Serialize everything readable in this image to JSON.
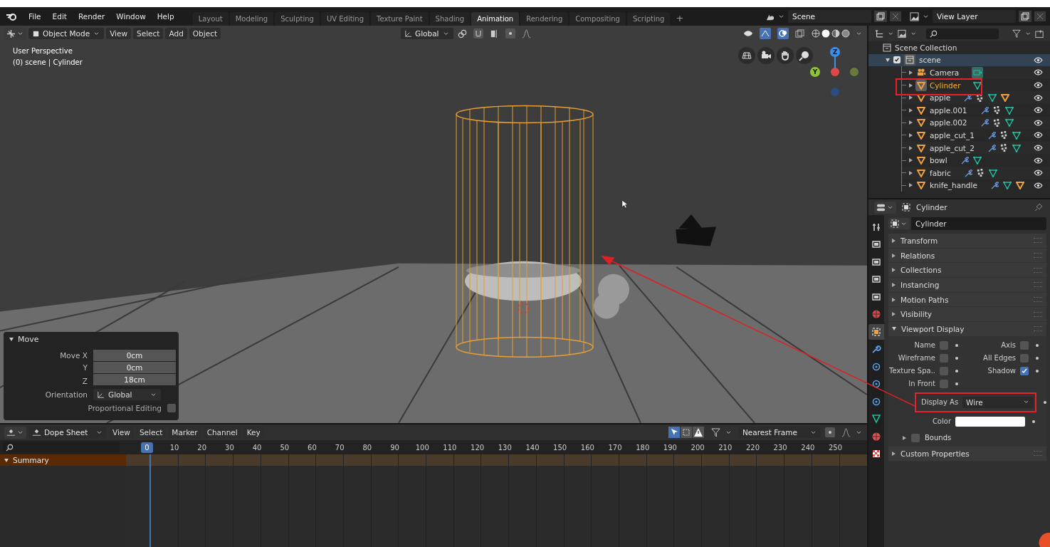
{
  "menu": [
    "File",
    "Edit",
    "Render",
    "Window",
    "Help"
  ],
  "workspaces": [
    {
      "label": "Layout",
      "selected": false
    },
    {
      "label": "Modeling",
      "selected": false
    },
    {
      "label": "Sculpting",
      "selected": false
    },
    {
      "label": "UV Editing",
      "selected": false
    },
    {
      "label": "Texture Paint",
      "selected": false
    },
    {
      "label": "Shading",
      "selected": false
    },
    {
      "label": "Animation",
      "selected": true
    },
    {
      "label": "Rendering",
      "selected": false
    },
    {
      "label": "Compositing",
      "selected": false
    },
    {
      "label": "Scripting",
      "selected": false
    }
  ],
  "add_workspace": "+",
  "scene": "Scene",
  "view_layer": "View Layer",
  "viewport": {
    "mode": "Object Mode",
    "menus": [
      "View",
      "Select",
      "Add",
      "Object"
    ],
    "orientation": "Global",
    "info": [
      "User Perspective",
      "(0) scene | Cylinder"
    ],
    "axes": [
      "Z",
      "Y"
    ]
  },
  "move_panel": {
    "title": "Move",
    "expanded": true,
    "fields": [
      {
        "label": "Move X",
        "value": "0cm"
      },
      {
        "label": "Y",
        "value": "0cm"
      },
      {
        "label": "Z",
        "value": "18cm"
      }
    ],
    "orientation_label": "Orientation",
    "orientation": "Global",
    "proportional_label": "Proportional Editing",
    "proportional": false
  },
  "dope_sheet": {
    "mode": "Dope Sheet",
    "menus": [
      "View",
      "Select",
      "Marker",
      "Channel",
      "Key"
    ],
    "snap": "Nearest Frame",
    "current_frame": "0",
    "frames": [
      "10",
      "20",
      "30",
      "40",
      "50",
      "60",
      "70",
      "80",
      "90",
      "100",
      "110",
      "120",
      "130",
      "140",
      "150",
      "160",
      "170",
      "180",
      "190",
      "200",
      "210",
      "220",
      "230",
      "240",
      "250"
    ],
    "summary": {
      "label": "Summary",
      "expanded": true
    }
  },
  "outliner": {
    "root": "Scene Collection",
    "collection": {
      "name": "scene",
      "checked": true,
      "expanded": true
    },
    "items": [
      {
        "name": "Camera",
        "kind": "camera",
        "selected": false,
        "icons": [
          {
            "kind": "camera_data"
          }
        ]
      },
      {
        "name": "Cylinder",
        "kind": "mesh",
        "selected": true,
        "icons": [
          {
            "kind": "mesh_data"
          }
        ]
      },
      {
        "name": "apple",
        "kind": "mesh",
        "selected": false,
        "icons": [
          {
            "kind": "modifier"
          },
          {
            "kind": "particles"
          },
          {
            "kind": "mesh_data"
          },
          {
            "kind": "object"
          }
        ]
      },
      {
        "name": "apple.001",
        "kind": "mesh",
        "selected": false,
        "icons": [
          {
            "kind": "modifier"
          },
          {
            "kind": "particles"
          },
          {
            "kind": "mesh_data"
          }
        ]
      },
      {
        "name": "apple.002",
        "kind": "mesh",
        "selected": false,
        "icons": [
          {
            "kind": "modifier"
          },
          {
            "kind": "particles"
          },
          {
            "kind": "mesh_data"
          }
        ]
      },
      {
        "name": "apple_cut_1",
        "kind": "mesh",
        "selected": false,
        "icons": [
          {
            "kind": "modifier"
          },
          {
            "kind": "particles"
          },
          {
            "kind": "mesh_data"
          }
        ]
      },
      {
        "name": "apple_cut_2",
        "kind": "mesh",
        "selected": false,
        "icons": [
          {
            "kind": "modifier"
          },
          {
            "kind": "particles"
          },
          {
            "kind": "mesh_data"
          }
        ]
      },
      {
        "name": "bowl",
        "kind": "mesh",
        "selected": false,
        "icons": [
          {
            "kind": "modifier"
          },
          {
            "kind": "mesh_data"
          }
        ]
      },
      {
        "name": "fabric",
        "kind": "mesh",
        "selected": false,
        "icons": [
          {
            "kind": "modifier"
          },
          {
            "kind": "particles"
          },
          {
            "kind": "mesh_data"
          }
        ]
      },
      {
        "name": "knife_handle",
        "kind": "mesh",
        "selected": false,
        "icons": [
          {
            "kind": "modifier"
          },
          {
            "kind": "mesh_data"
          },
          {
            "kind": "object"
          }
        ]
      }
    ]
  },
  "properties": {
    "title": "Cylinder",
    "name": "Cylinder",
    "tabs": [
      {
        "kind": "tool",
        "selected": false
      },
      {
        "kind": "render",
        "selected": false
      },
      {
        "kind": "output",
        "selected": false
      },
      {
        "kind": "view_layer",
        "selected": false
      },
      {
        "kind": "scene",
        "selected": false
      },
      {
        "kind": "world",
        "selected": false
      },
      {
        "kind": "object",
        "selected": true
      },
      {
        "kind": "modifier",
        "selected": false
      },
      {
        "kind": "particles",
        "selected": false
      },
      {
        "kind": "physics",
        "selected": false
      },
      {
        "kind": "constraint",
        "selected": false
      },
      {
        "kind": "data",
        "selected": false
      },
      {
        "kind": "material",
        "selected": false
      },
      {
        "kind": "texture",
        "selected": false
      }
    ],
    "panels": [
      {
        "label": "Transform",
        "expanded": false
      },
      {
        "label": "Relations",
        "expanded": false
      },
      {
        "label": "Collections",
        "expanded": false
      },
      {
        "label": "Instancing",
        "expanded": false
      },
      {
        "label": "Motion Paths",
        "expanded": false
      },
      {
        "label": "Visibility",
        "expanded": false
      },
      {
        "label": "Viewport Display",
        "expanded": true
      }
    ],
    "display": {
      "checks": [
        {
          "label": "Name",
          "checked": false
        },
        {
          "label": "Axis",
          "checked": false
        },
        {
          "label": "Wireframe",
          "checked": false
        },
        {
          "label": "All Edges",
          "checked": false
        },
        {
          "label": "Texture Spa..",
          "checked": false
        },
        {
          "label": "Shadow",
          "checked": true
        },
        {
          "label": "In Front",
          "checked": false
        }
      ],
      "display_as_label": "Display As",
      "display_as": "Wire",
      "color_label": "Color",
      "bounds": {
        "label": "Bounds",
        "checked": false,
        "expanded": false
      }
    },
    "after_panels": [
      {
        "label": "Custom Properties",
        "expanded": false
      }
    ]
  }
}
